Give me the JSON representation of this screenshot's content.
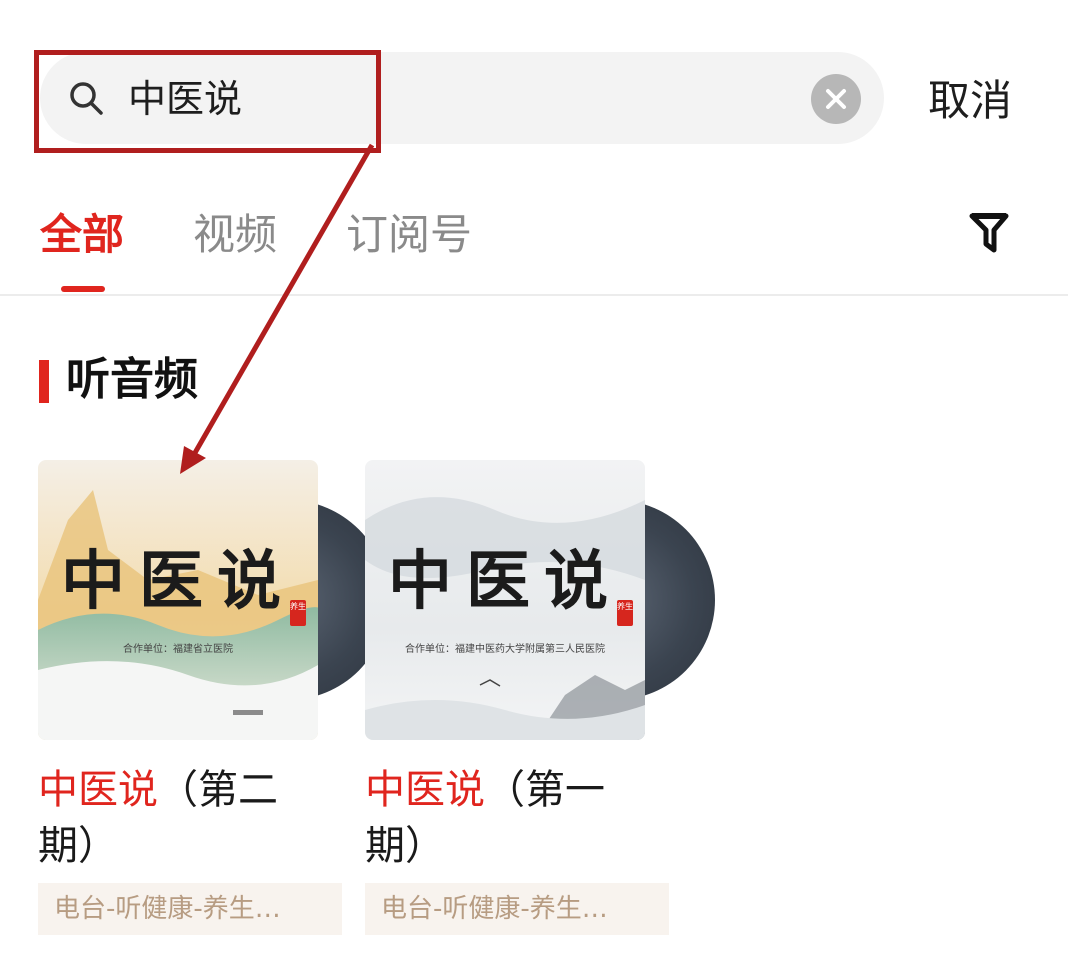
{
  "search": {
    "query": "中医说",
    "cancel_label": "取消"
  },
  "tabs": [
    {
      "label": "全部",
      "active": true
    },
    {
      "label": "视频",
      "active": false
    },
    {
      "label": "订阅号",
      "active": false
    }
  ],
  "section": {
    "title": "听音频"
  },
  "cards": [
    {
      "cover_title": "中医说",
      "cover_subtitle": "合作单位：福建省立医院",
      "cover_seal": "养生",
      "title_highlight": "中医说",
      "title_rest": "（第二期）",
      "tag": "电台-听健康-养生…"
    },
    {
      "cover_title": "中医说",
      "cover_subtitle": "合作单位：福建中医药大学附属第三人民医院",
      "cover_seal": "养生",
      "title_highlight": "中医说",
      "title_rest": "（第一期）",
      "tag": "电台-听健康-养生…"
    }
  ],
  "colors": {
    "accent": "#e0251e",
    "annotation": "#b01e1e",
    "tag_bg": "#f8f3ee",
    "tag_text": "#b79c82"
  },
  "icons": [
    "search-icon",
    "clear-icon",
    "filter-icon",
    "arrow-annotation"
  ]
}
